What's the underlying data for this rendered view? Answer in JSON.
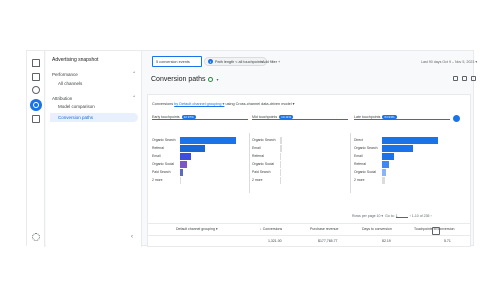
{
  "nav": {
    "header": "Advertising snapshot",
    "performance_label": "Performance",
    "performance_item": "All channels",
    "attribution_label": "Attribution",
    "attribution_items": [
      "Model comparison",
      "Conversion paths"
    ],
    "collapse_glyph": "‹"
  },
  "filters": {
    "conversion_events": "5 conversion events",
    "path_length_badge": "1",
    "path_length": "Path length < all touchpoints",
    "add_filter": "Add filter +",
    "date_range": "Last 90 days  Oct 9 – Nov 5, 2023 ▾"
  },
  "page": {
    "title": "Conversion paths",
    "title_caret": "▾"
  },
  "card": {
    "grouping_label": "Conversions",
    "grouping_link": "by Default channel grouping ▾",
    "model_text": " using Cross-channel data-driven model ▾"
  },
  "stages": [
    {
      "label": "Early touchpoints",
      "pct": "22.97%",
      "rows": [
        {
          "label": "Organic Search",
          "value": 1.0,
          "color": "#1a73e8"
        },
        {
          "label": "Referral",
          "value": 0.45,
          "color": "#1967d2"
        },
        {
          "label": "Email",
          "value": 0.2,
          "color": "#3c4de0"
        },
        {
          "label": "Organic Social",
          "value": 0.12,
          "color": "#7e57c2"
        },
        {
          "label": "Paid Search",
          "value": 0.05,
          "color": "#5c6bc0"
        },
        {
          "label": "2 more",
          "value": 0.0,
          "color": "#dadce0"
        }
      ]
    },
    {
      "label": "Mid touchpoints",
      "pct": "13.11%",
      "rows": [
        {
          "label": "Organic Search",
          "value": 0.04,
          "color": "#dadce0"
        },
        {
          "label": "Email",
          "value": 0.03,
          "color": "#dadce0"
        },
        {
          "label": "Referral",
          "value": 0.02,
          "color": "#dadce0"
        },
        {
          "label": "Organic Social",
          "value": 0.02,
          "color": "#dadce0"
        },
        {
          "label": "Paid Search",
          "value": 0.01,
          "color": "#dadce0"
        },
        {
          "label": "2 more",
          "value": 0.01,
          "color": "#dadce0"
        }
      ]
    },
    {
      "label": "Late touchpoints",
      "pct": "64.93%",
      "rows": [
        {
          "label": "Direct",
          "value": 1.0,
          "color": "#1a73e8"
        },
        {
          "label": "Organic Search",
          "value": 0.55,
          "color": "#1a73e8"
        },
        {
          "label": "Email",
          "value": 0.22,
          "color": "#1a73e8"
        },
        {
          "label": "Referral",
          "value": 0.13,
          "color": "#4285f4"
        },
        {
          "label": "Organic Social",
          "value": 0.08,
          "color": "#8ab4f8"
        },
        {
          "label": "2 more",
          "value": 0.06,
          "color": "#dadce0"
        }
      ]
    }
  ],
  "pager": {
    "rows_label": "Rows per page",
    "rows_value": "10 ▾",
    "goto_label": "Go to:",
    "goto_value": "1",
    "range": "1-10 of 235"
  },
  "table": {
    "headers": [
      "Default channel grouping ▾",
      "↓ Conversions",
      "Purchase revenue",
      "Days to conversion",
      "Touchpoints to conversion"
    ],
    "totals": [
      "",
      "1,321.00",
      "$177,765.77",
      "82.19",
      "5.71"
    ]
  }
}
